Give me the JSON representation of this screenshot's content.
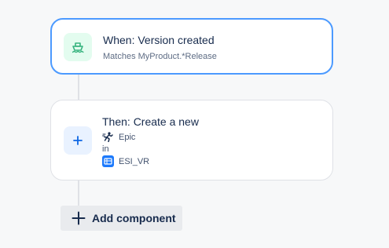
{
  "trigger": {
    "title": "When: Version created",
    "subtitle": "Matches MyProduct.*Release",
    "icon": "ship-icon",
    "icon_color": "#36b37e",
    "icon_bg": "#e3fcef"
  },
  "action": {
    "title": "Then: Create a new",
    "issue_type": "Epic",
    "issue_type_icon": "epic-runner-icon",
    "preposition": "in",
    "project": "ESI_VR",
    "project_icon": "project-avatar-icon",
    "icon": "plus-icon",
    "icon_color": "#0c66e4",
    "icon_bg": "#e9f2ff"
  },
  "add_component": {
    "label": "Add component",
    "icon": "plus-icon"
  },
  "colors": {
    "accent_border": "#4c9aff",
    "connector": "#dfe1e6",
    "background": "#f7f8f9"
  }
}
